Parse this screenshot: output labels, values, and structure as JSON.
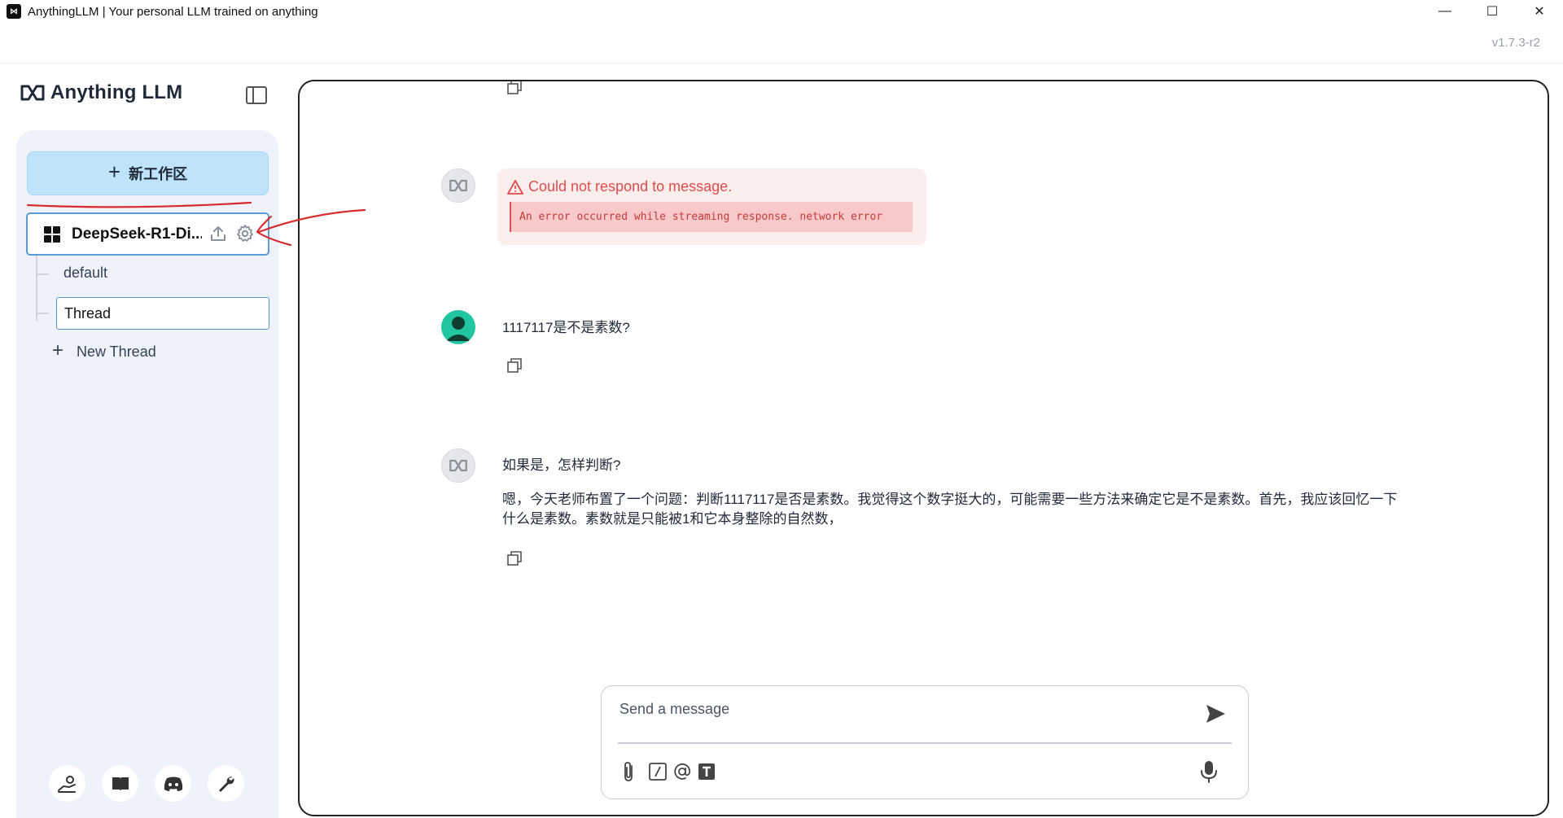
{
  "window": {
    "title": "AnythingLLM | Your personal LLM trained on anything",
    "app_icon": "anythingllm-logo-icon",
    "controls": [
      "minimize-icon",
      "maximize-icon",
      "close-icon"
    ]
  },
  "header": {
    "version": "v1.7.3-r2"
  },
  "brand": {
    "name": "Anything LLM"
  },
  "sidebar": {
    "new_workspace_label": "新工作区",
    "workspace": {
      "name": "DeepSeek-R1-Di...",
      "icons": [
        "upload-icon",
        "gear-icon"
      ]
    },
    "threads": [
      {
        "label": "default",
        "active": false
      },
      {
        "label": "Thread",
        "active": true
      }
    ],
    "new_thread_label": "New Thread",
    "footer_icons": [
      "community-hub-icon",
      "docs-book-icon",
      "discord-icon",
      "settings-wrench-icon"
    ]
  },
  "chat": {
    "error": {
      "title": "Could not respond to message.",
      "detail": "An error occurred while streaming response. network error"
    },
    "user_message": "1117117是不是素数?",
    "assistant_message": {
      "line1": "如果是，怎样判断?",
      "line2": "嗯，今天老师布置了一个问题：判断1117117是否是素数。我觉得这个数字挺大的，可能需要一些方法来确定它是不是素数。首先，我应该回忆一下什么是素数。素数就是只能被1和它本身整除的自然数，"
    }
  },
  "composer": {
    "placeholder": "Send a message",
    "tools": [
      "attach-icon",
      "slash-command-icon",
      "at-mention-icon",
      "text-size-icon"
    ]
  },
  "colors": {
    "accent": "#bfe3fb",
    "error": "#e34b4b",
    "annotation": "#d92b2b"
  }
}
